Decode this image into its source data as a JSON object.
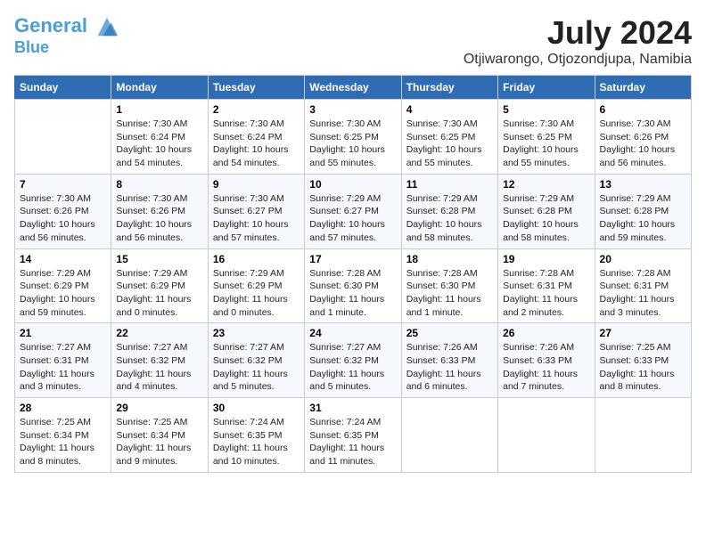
{
  "header": {
    "logo_line1": "General",
    "logo_line2": "Blue",
    "month": "July 2024",
    "location": "Otjiwarongo, Otjozondjupa, Namibia"
  },
  "columns": [
    "Sunday",
    "Monday",
    "Tuesday",
    "Wednesday",
    "Thursday",
    "Friday",
    "Saturday"
  ],
  "weeks": [
    [
      {
        "day": "",
        "info": ""
      },
      {
        "day": "1",
        "info": "Sunrise: 7:30 AM\nSunset: 6:24 PM\nDaylight: 10 hours\nand 54 minutes."
      },
      {
        "day": "2",
        "info": "Sunrise: 7:30 AM\nSunset: 6:24 PM\nDaylight: 10 hours\nand 54 minutes."
      },
      {
        "day": "3",
        "info": "Sunrise: 7:30 AM\nSunset: 6:25 PM\nDaylight: 10 hours\nand 55 minutes."
      },
      {
        "day": "4",
        "info": "Sunrise: 7:30 AM\nSunset: 6:25 PM\nDaylight: 10 hours\nand 55 minutes."
      },
      {
        "day": "5",
        "info": "Sunrise: 7:30 AM\nSunset: 6:25 PM\nDaylight: 10 hours\nand 55 minutes."
      },
      {
        "day": "6",
        "info": "Sunrise: 7:30 AM\nSunset: 6:26 PM\nDaylight: 10 hours\nand 56 minutes."
      }
    ],
    [
      {
        "day": "7",
        "info": "Sunrise: 7:30 AM\nSunset: 6:26 PM\nDaylight: 10 hours\nand 56 minutes."
      },
      {
        "day": "8",
        "info": "Sunrise: 7:30 AM\nSunset: 6:26 PM\nDaylight: 10 hours\nand 56 minutes."
      },
      {
        "day": "9",
        "info": "Sunrise: 7:30 AM\nSunset: 6:27 PM\nDaylight: 10 hours\nand 57 minutes."
      },
      {
        "day": "10",
        "info": "Sunrise: 7:29 AM\nSunset: 6:27 PM\nDaylight: 10 hours\nand 57 minutes."
      },
      {
        "day": "11",
        "info": "Sunrise: 7:29 AM\nSunset: 6:28 PM\nDaylight: 10 hours\nand 58 minutes."
      },
      {
        "day": "12",
        "info": "Sunrise: 7:29 AM\nSunset: 6:28 PM\nDaylight: 10 hours\nand 58 minutes."
      },
      {
        "day": "13",
        "info": "Sunrise: 7:29 AM\nSunset: 6:28 PM\nDaylight: 10 hours\nand 59 minutes."
      }
    ],
    [
      {
        "day": "14",
        "info": "Sunrise: 7:29 AM\nSunset: 6:29 PM\nDaylight: 10 hours\nand 59 minutes."
      },
      {
        "day": "15",
        "info": "Sunrise: 7:29 AM\nSunset: 6:29 PM\nDaylight: 11 hours\nand 0 minutes."
      },
      {
        "day": "16",
        "info": "Sunrise: 7:29 AM\nSunset: 6:29 PM\nDaylight: 11 hours\nand 0 minutes."
      },
      {
        "day": "17",
        "info": "Sunrise: 7:28 AM\nSunset: 6:30 PM\nDaylight: 11 hours\nand 1 minute."
      },
      {
        "day": "18",
        "info": "Sunrise: 7:28 AM\nSunset: 6:30 PM\nDaylight: 11 hours\nand 1 minute."
      },
      {
        "day": "19",
        "info": "Sunrise: 7:28 AM\nSunset: 6:31 PM\nDaylight: 11 hours\nand 2 minutes."
      },
      {
        "day": "20",
        "info": "Sunrise: 7:28 AM\nSunset: 6:31 PM\nDaylight: 11 hours\nand 3 minutes."
      }
    ],
    [
      {
        "day": "21",
        "info": "Sunrise: 7:27 AM\nSunset: 6:31 PM\nDaylight: 11 hours\nand 3 minutes."
      },
      {
        "day": "22",
        "info": "Sunrise: 7:27 AM\nSunset: 6:32 PM\nDaylight: 11 hours\nand 4 minutes."
      },
      {
        "day": "23",
        "info": "Sunrise: 7:27 AM\nSunset: 6:32 PM\nDaylight: 11 hours\nand 5 minutes."
      },
      {
        "day": "24",
        "info": "Sunrise: 7:27 AM\nSunset: 6:32 PM\nDaylight: 11 hours\nand 5 minutes."
      },
      {
        "day": "25",
        "info": "Sunrise: 7:26 AM\nSunset: 6:33 PM\nDaylight: 11 hours\nand 6 minutes."
      },
      {
        "day": "26",
        "info": "Sunrise: 7:26 AM\nSunset: 6:33 PM\nDaylight: 11 hours\nand 7 minutes."
      },
      {
        "day": "27",
        "info": "Sunrise: 7:25 AM\nSunset: 6:33 PM\nDaylight: 11 hours\nand 8 minutes."
      }
    ],
    [
      {
        "day": "28",
        "info": "Sunrise: 7:25 AM\nSunset: 6:34 PM\nDaylight: 11 hours\nand 8 minutes."
      },
      {
        "day": "29",
        "info": "Sunrise: 7:25 AM\nSunset: 6:34 PM\nDaylight: 11 hours\nand 9 minutes."
      },
      {
        "day": "30",
        "info": "Sunrise: 7:24 AM\nSunset: 6:35 PM\nDaylight: 11 hours\nand 10 minutes."
      },
      {
        "day": "31",
        "info": "Sunrise: 7:24 AM\nSunset: 6:35 PM\nDaylight: 11 hours\nand 11 minutes."
      },
      {
        "day": "",
        "info": ""
      },
      {
        "day": "",
        "info": ""
      },
      {
        "day": "",
        "info": ""
      }
    ]
  ]
}
